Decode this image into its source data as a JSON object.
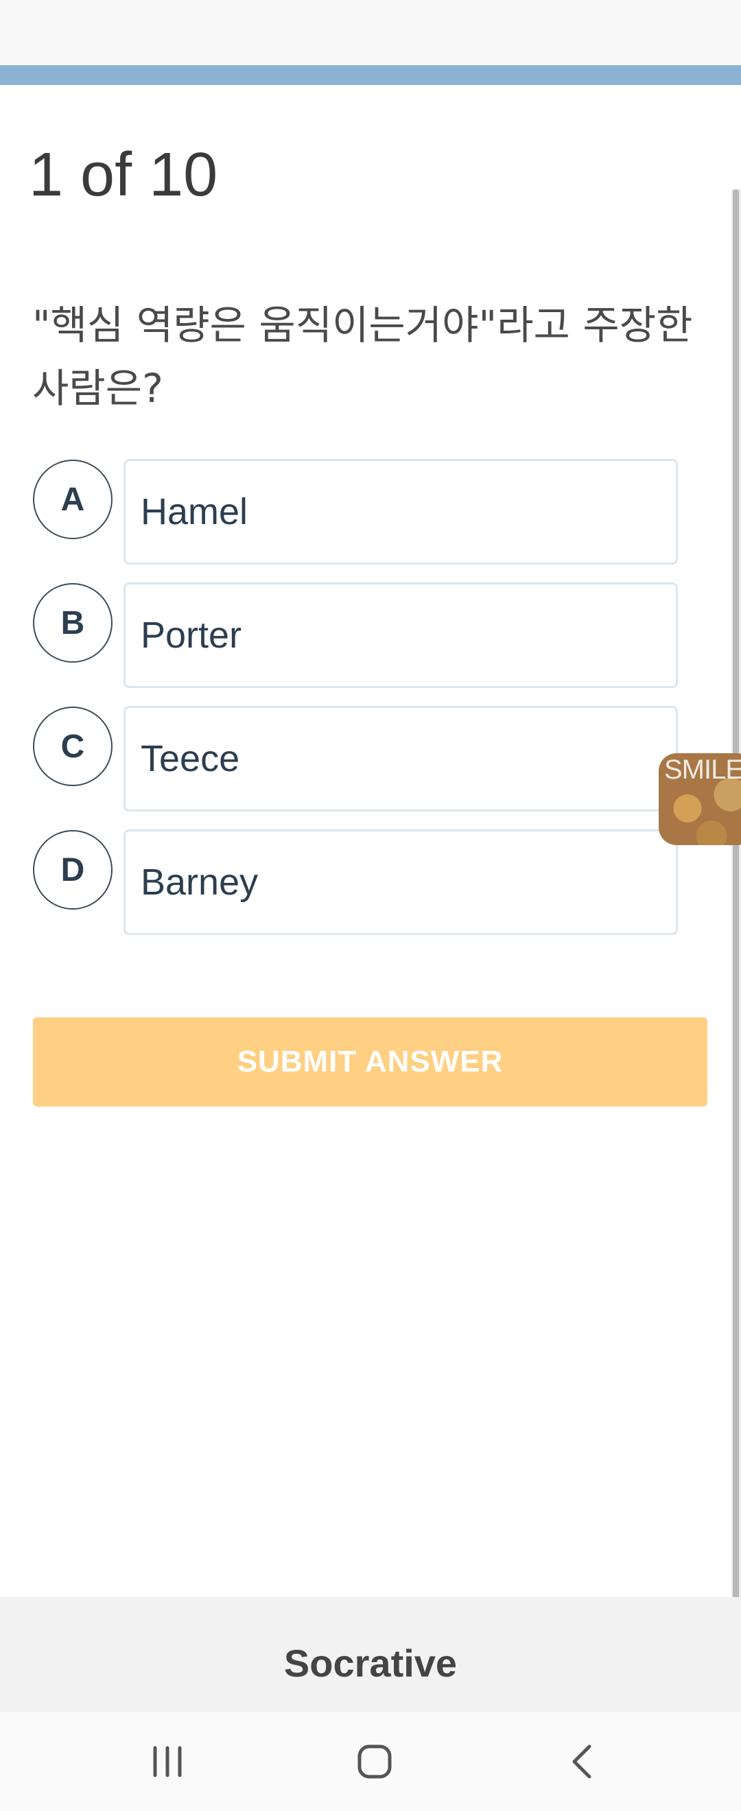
{
  "quiz": {
    "counter": "1 of 10",
    "question": "\"핵심 역량은 움직이는거야\"라고 주장한 사람은?",
    "choices": [
      {
        "letter": "A",
        "text": "Hamel"
      },
      {
        "letter": "B",
        "text": "Porter"
      },
      {
        "letter": "C",
        "text": "Teece"
      },
      {
        "letter": "D",
        "text": "Barney"
      }
    ],
    "submit_label": "SUBMIT ANSWER"
  },
  "floating_widget": {
    "label": "SMILE"
  },
  "footer": {
    "brand": "Socrative"
  },
  "navbar": {
    "icons": [
      "recent-apps-icon",
      "home-icon",
      "back-icon"
    ]
  },
  "colors": {
    "progress_strip": "#8cb3d4",
    "submit_button": "#ffd083",
    "choice_border": "#dce6ee"
  }
}
